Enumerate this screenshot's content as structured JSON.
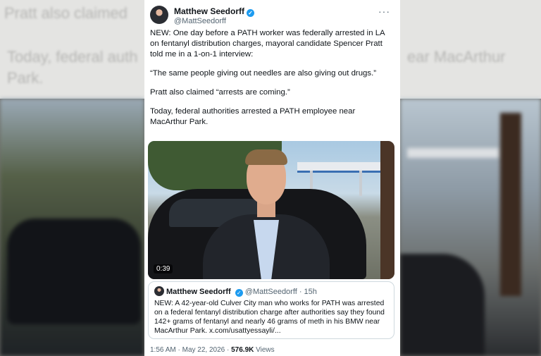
{
  "background": {
    "line1": "Pratt also claimed",
    "line2a": "Today, federal auth",
    "line2b": "ear MacArthur",
    "line3": "Park."
  },
  "tweet": {
    "display_name": "Matthew Seedorff",
    "handle": "@MattSeedorff",
    "more_label": "···",
    "paragraphs": [
      "NEW: One day before a PATH worker was federally arrested in LA on fentanyl distribution charges, mayoral candidate Spencer Pratt told me in a 1-on-1 interview:",
      "“The same people giving out needles are also giving out drugs.”",
      "Pratt also claimed “arrests are coming.”",
      "Today, federal authorities arrested a PATH employee near MacArthur Park."
    ],
    "video_duration": "0:39",
    "quoted": {
      "display_name": "Matthew Seedorff",
      "handle": "@MattSeedorff",
      "time": "· 15h",
      "text": "NEW: A 42-year-old Culver City man who works for PATH was arrested on a federal fentanyl distribution charge after authorities say they found 142+ grams of fentanyl and nearly 46 grams of meth in his BMW near MacArthur Park. x.com/usattyessayli/..."
    },
    "time": "1:56 AM",
    "sep1": "·",
    "date": "May 22, 2026",
    "sep2": "·",
    "views_count": "576.9K",
    "views_label": "Views"
  },
  "colors": {
    "verified": "#1d9bf0",
    "text": "#0f1419",
    "secondary": "#536471"
  }
}
